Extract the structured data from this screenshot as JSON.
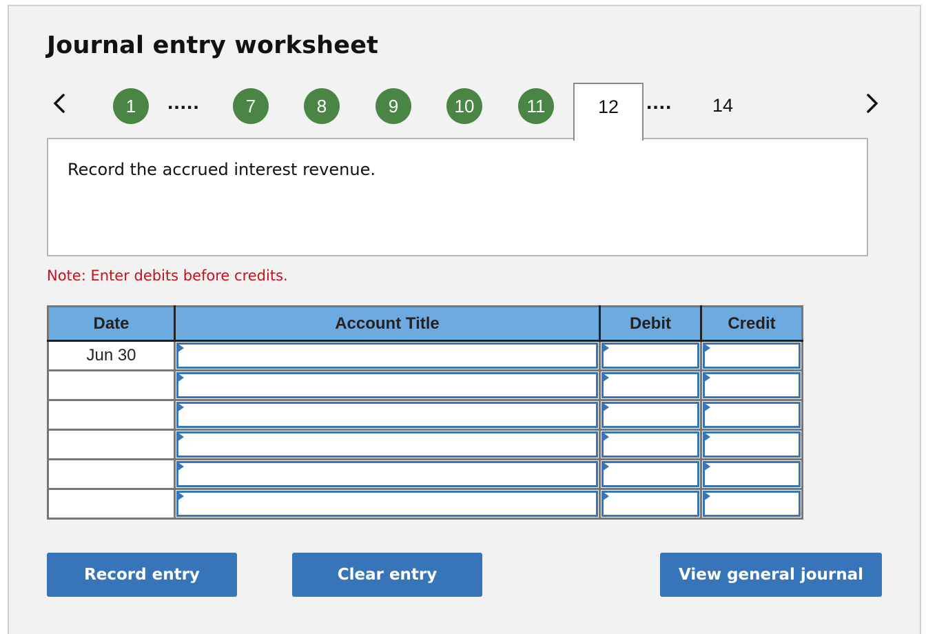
{
  "header": {
    "title": "Journal entry worksheet"
  },
  "stepper": {
    "prev_icon": "chevron-left-icon",
    "next_icon": "chevron-right-icon",
    "completed_steps": [
      "1",
      "7",
      "8",
      "9",
      "10",
      "11"
    ],
    "ellipsis_1": ".....",
    "ellipsis_2": "....",
    "current_step": "12",
    "last_step": "14",
    "completed_color": "#4a8545"
  },
  "question": {
    "text": "Record the accrued interest revenue."
  },
  "note": {
    "text": "Note: Enter debits before credits.",
    "color": "#c0141c"
  },
  "journal_table": {
    "headers": {
      "date": "Date",
      "account": "Account Title",
      "debit": "Debit",
      "credit": "Credit"
    },
    "header_color": "#6daae0",
    "rows": [
      {
        "date": "Jun 30",
        "account": "",
        "debit": "",
        "credit": ""
      },
      {
        "date": "",
        "account": "",
        "debit": "",
        "credit": ""
      },
      {
        "date": "",
        "account": "",
        "debit": "",
        "credit": ""
      },
      {
        "date": "",
        "account": "",
        "debit": "",
        "credit": ""
      },
      {
        "date": "",
        "account": "",
        "debit": "",
        "credit": ""
      },
      {
        "date": "",
        "account": "",
        "debit": "",
        "credit": ""
      }
    ]
  },
  "buttons": {
    "record": "Record entry",
    "clear": "Clear entry",
    "view_journal": "View general journal",
    "color": "#3875b8"
  }
}
